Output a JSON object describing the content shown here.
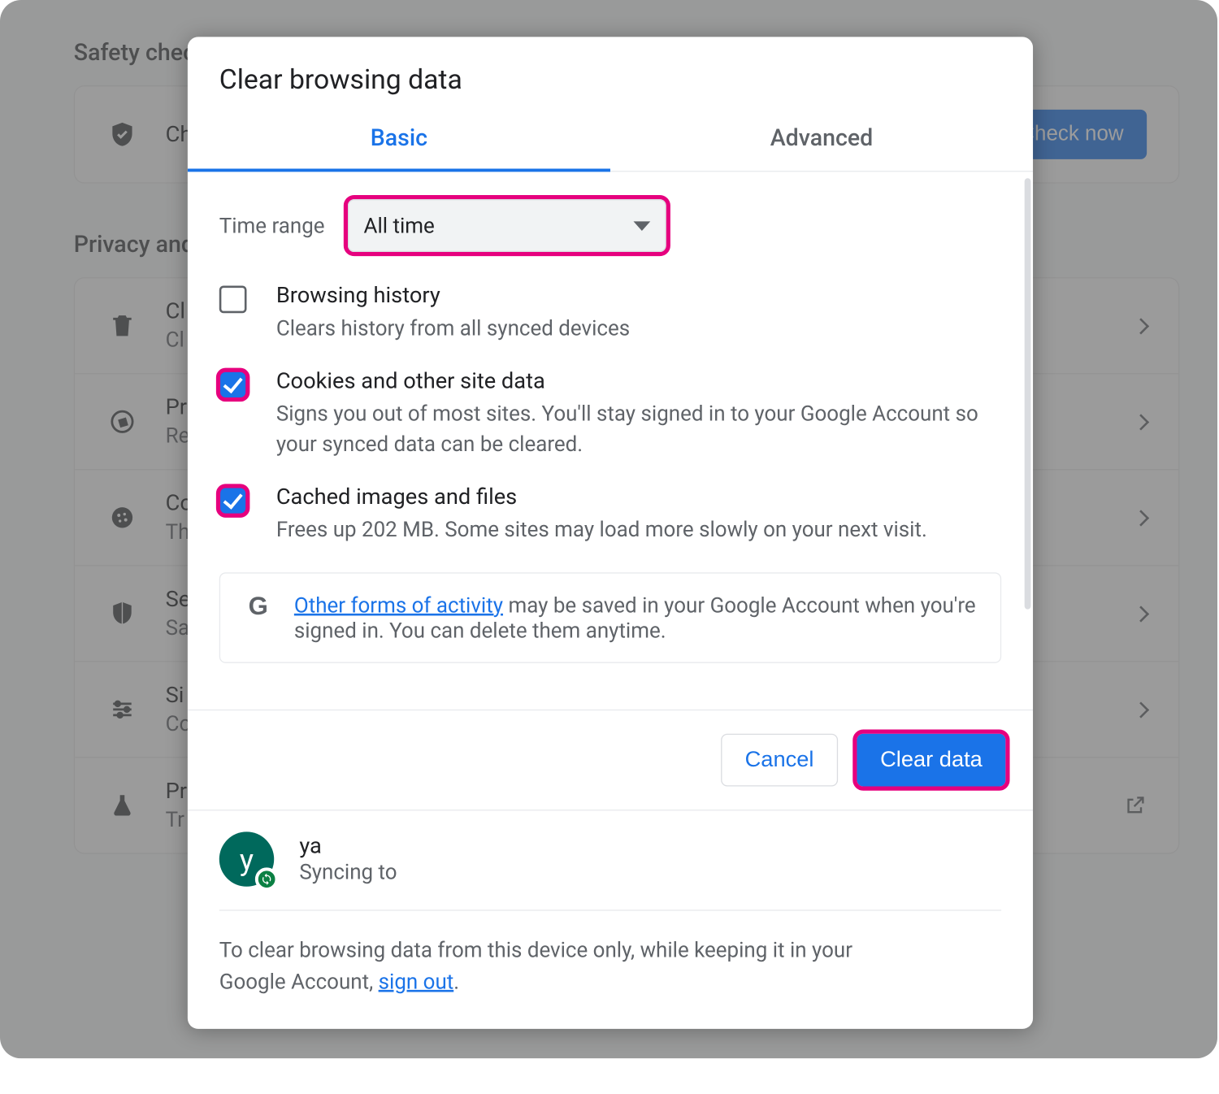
{
  "background": {
    "section_safety": "Safety check",
    "safety_row_text": "Ch",
    "check_now": "Check now",
    "section_privacy": "Privacy and",
    "rows": [
      {
        "title": "Cl",
        "sub": "Cl",
        "icon": "trash-icon"
      },
      {
        "title": "Pr",
        "sub": "Re",
        "icon": "compass-icon"
      },
      {
        "title": "Co",
        "sub": "Th",
        "icon": "cookie-icon"
      },
      {
        "title": "Se",
        "sub": "Sa",
        "icon": "shield-icon"
      },
      {
        "title": "Si",
        "sub": "Co",
        "icon": "sliders-icon"
      },
      {
        "title": "Pr",
        "sub": "Tr",
        "icon": "flask-icon",
        "external": true
      }
    ]
  },
  "modal": {
    "title": "Clear browsing data",
    "tabs": {
      "basic": "Basic",
      "advanced": "Advanced",
      "active": "basic"
    },
    "time_range": {
      "label": "Time range",
      "selected": "All time"
    },
    "options": [
      {
        "title": "Browsing history",
        "desc": "Clears history from all synced devices",
        "checked": false,
        "highlighted": false
      },
      {
        "title": "Cookies and other site data",
        "desc": "Signs you out of most sites. You'll stay signed in to your Google Account so your synced data can be cleared.",
        "checked": true,
        "highlighted": true
      },
      {
        "title": "Cached images and files",
        "desc": "Frees up 202 MB. Some sites may load more slowly on your next visit.",
        "checked": true,
        "highlighted": true
      }
    ],
    "info": {
      "link": "Other forms of activity",
      "text_after": " may be saved in your Google Account when you're signed in. You can delete them anytime."
    },
    "buttons": {
      "cancel": "Cancel",
      "clear": "Clear data"
    },
    "account": {
      "name": "ya",
      "status": "Syncing to",
      "avatar_letter": "y"
    },
    "footer": {
      "text_before": "To clear browsing data from this device only, while keeping it in your Google Account, ",
      "link": "sign out",
      "text_after": "."
    }
  }
}
